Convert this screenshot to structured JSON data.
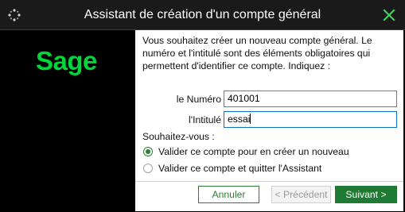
{
  "window": {
    "title": "Assistant de création d'un compte général"
  },
  "brand": {
    "logo_text": "Sage",
    "logo_color": "#00d639"
  },
  "intro": {
    "text": "Vous souhaitez créer un nouveau compte général. Le numéro et l'intitulé sont des éléments obligatoires qui permettent d'identifier ce compte. Indiquez :"
  },
  "form": {
    "numero_label": "le Numéro",
    "numero_value": "401001",
    "intitule_label": "l'Intitulé",
    "intitule_value": "essai"
  },
  "choice": {
    "heading": "Souhaitez-vous :",
    "options": [
      {
        "label": "Valider ce compte pour en créer un nouveau",
        "selected": true
      },
      {
        "label": "Valider ce compte et quitter l'Assistant",
        "selected": false
      }
    ]
  },
  "buttons": {
    "cancel": "Annuler",
    "previous": "< Précédent",
    "next": "Suivant >"
  },
  "colors": {
    "accent": "#1f7a33",
    "close_icon": "#3fcf5a"
  }
}
